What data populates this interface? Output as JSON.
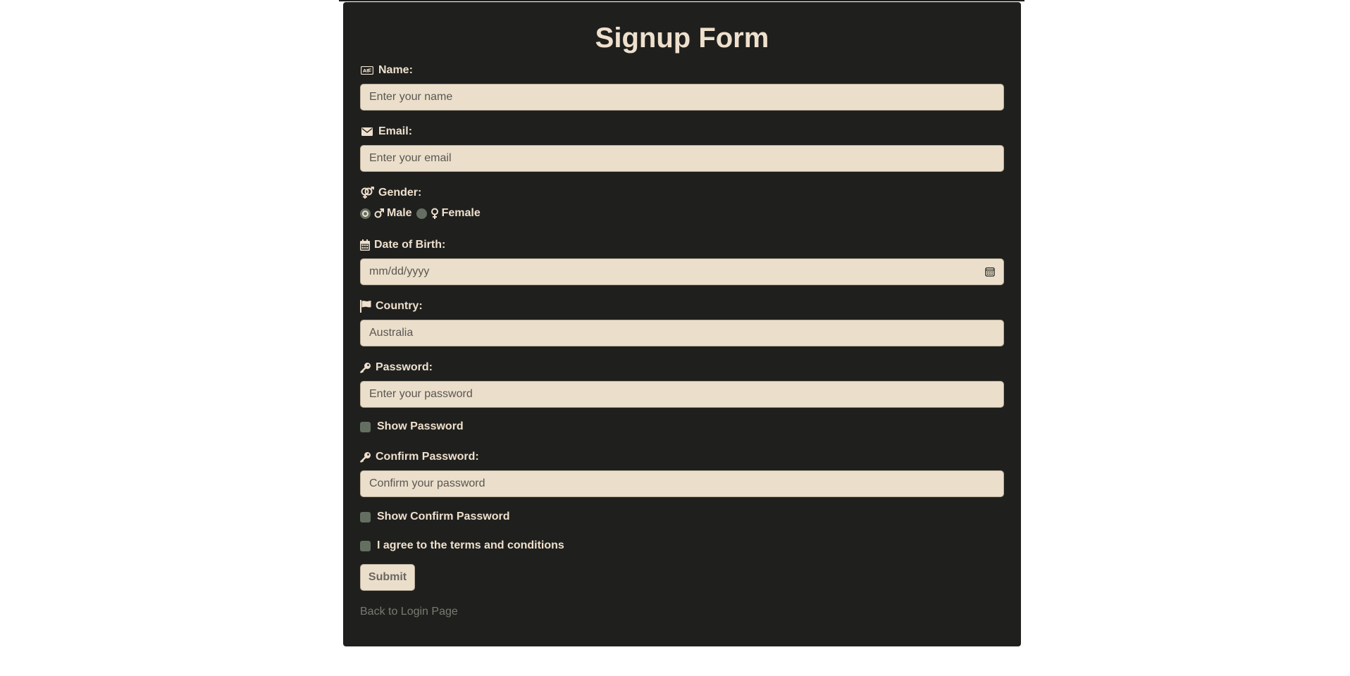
{
  "form": {
    "title": "Signup Form",
    "name": {
      "label": "Name:",
      "placeholder": "Enter your name"
    },
    "email": {
      "label": "Email:",
      "placeholder": "Enter your email"
    },
    "gender": {
      "label": "Gender:",
      "options": [
        {
          "label": "Male",
          "selected": true
        },
        {
          "label": "Female",
          "selected": false
        }
      ]
    },
    "dob": {
      "label": "Date of Birth:",
      "placeholder": "mm/dd/yyyy"
    },
    "country": {
      "label": "Country:",
      "value": "Australia"
    },
    "password": {
      "label": "Password:",
      "placeholder": "Enter your password"
    },
    "show_password": "Show Password",
    "confirm_password": {
      "label": "Confirm Password:",
      "placeholder": "Confirm your password"
    },
    "show_confirm_password": "Show Confirm Password",
    "terms": "I agree to the terms and conditions",
    "submit_label": "Submit",
    "back_link": "Back to Login Page"
  },
  "colors": {
    "card_background": "#1f201e",
    "text": "#efe0cd",
    "field_background": "#ebdfcc",
    "control": "#646f61"
  },
  "icons": {
    "name": "id-card-icon",
    "email": "envelope-icon",
    "gender": "venus-mars-icon",
    "male": "mars-icon",
    "female": "venus-icon",
    "dob": "calendar-icon",
    "country": "flag-icon",
    "password": "key-icon",
    "date_picker": "calendar-picker-icon"
  }
}
